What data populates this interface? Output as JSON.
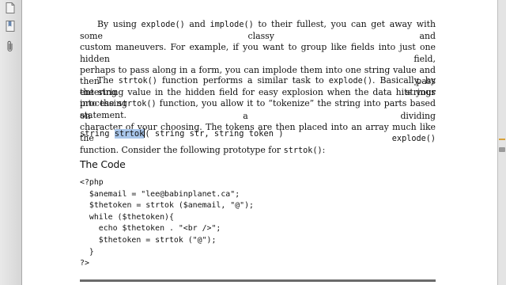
{
  "sidebar": {
    "icons": [
      "page-view-icon",
      "bookmark-icon",
      "attachment-icon"
    ]
  },
  "content": {
    "p1": {
      "l1a": "By using ",
      "l1b": "explode()",
      "l1c": " and ",
      "l1d": "implode()",
      "l1e": " to their fullest, you can get away with some classy and",
      "l2": "custom maneuvers. For example, if you want to group like fields into just one hidden field,",
      "l3": "perhaps to pass along in a form, you can implode them into one string value and then pass",
      "l4": "the string value in the hidden field for easy explosion when the data hits your processing",
      "l5": "statement."
    },
    "p2": {
      "l1a": "The ",
      "l1b": "strtok()",
      "l1c": " function performs a similar task to ",
      "l1d": "explode()",
      "l1e": ". Basically, by entering strings",
      "l2a": "into the ",
      "l2b": "strtok()",
      "l2c": " function, you allow it to “tokenize” the string into parts based on a dividing",
      "l3a": "character of your choosing. The tokens are then placed into an array much like the ",
      "l3b": "explode()",
      "l4a": "function. Consider the following prototype for ",
      "l4b": "strtok()",
      "l4c": ":"
    },
    "prototype": {
      "pre": "string ",
      "highlight": "strtok",
      "post": "( string str, string token )"
    },
    "heading": "The Code",
    "code_lines": [
      "<?php",
      "  $anemail = \"lee@babinplanet.ca\";",
      "  $thetoken = strtok ($anemail, \"@\");",
      "  while ($thetoken){",
      "    echo $thetoken . \"<br />\";",
      "    $thetoken = strtok (\"@\");",
      "  }",
      "?>"
    ]
  },
  "colors": {
    "selection": "#a9c6ea",
    "scroll_marker": "#d8a23a"
  }
}
